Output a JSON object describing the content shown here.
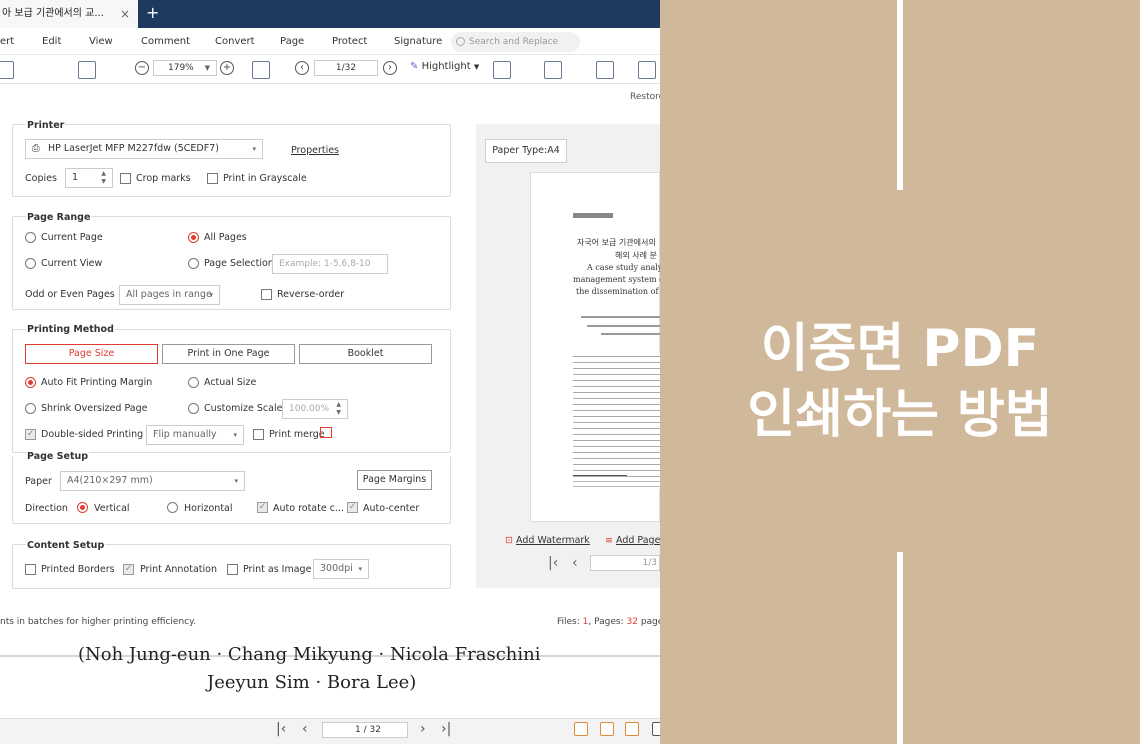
{
  "app": {
    "tab_title": "아 보급 기관에서의 교...",
    "tab_close": "×",
    "new_tab": "+",
    "menu": [
      "ert",
      "Edit",
      "View",
      "Comment",
      "Convert",
      "Page",
      "Protect",
      "Signature"
    ],
    "search_placeholder": "Search and Replace",
    "zoom": "179%",
    "page_indicator": "1/32",
    "highlight_label": "Hightlight"
  },
  "dialog": {
    "restore": "Restore",
    "printer": {
      "title": "Printer",
      "name": "HP LaserJet MFP M227fdw (5CEDF7)",
      "properties": "Properties",
      "copies_label": "Copies",
      "copies_value": "1",
      "crop_marks": "Crop marks",
      "grayscale": "Print in Grayscale"
    },
    "page_range": {
      "title": "Page Range",
      "current_page": "Current Page",
      "all_pages": "All Pages",
      "current_view": "Current View",
      "page_selection": "Page Selection",
      "selection_placeholder": "Example: 1-5,6,8-10",
      "odd_even_label": "Odd or Even Pages",
      "odd_even_value": "All pages in range",
      "reverse_order": "Reverse-order"
    },
    "printing_method": {
      "title": "Printing Method",
      "tabs": [
        "Page Size",
        "Print in One Page",
        "Booklet"
      ],
      "auto_fit": "Auto Fit Printing Margin",
      "actual_size": "Actual Size",
      "shrink": "Shrink Oversized Page",
      "custom_scale": "Customize Scale",
      "scale_value": "100.00%",
      "double_sided": "Double-sided Printing",
      "flip_value": "Flip manually",
      "print_merge": "Print merge"
    },
    "page_setup": {
      "title": "Page Setup",
      "paper_label": "Paper",
      "paper_value": "A4(210×297 mm)",
      "page_margins": "Page Margins",
      "direction_label": "Direction",
      "vertical": "Vertical",
      "horizontal": "Horizontal",
      "auto_rotate": "Auto rotate c...",
      "auto_center": "Auto-center"
    },
    "content_setup": {
      "title": "Content Setup",
      "printed_borders": "Printed Borders",
      "print_annotation": "Print Annotation",
      "print_as_image": "Print as Image",
      "dpi_value": "300dpi"
    },
    "preview": {
      "paper_type": "Paper Type:A4",
      "add_watermark": "Add Watermark",
      "add_page": "Add Page",
      "page_value": "1/3",
      "doc_title_1": "자국어 보급 기관에서의",
      "doc_title_2": "해외 사례 분",
      "doc_sub_1": "A case study analys",
      "doc_sub_2": "management system of",
      "doc_sub_3": "the dissemination of th"
    },
    "footer_note": "nts in batches for higher printing efficiency.",
    "files_label": "Files:",
    "files_count": "1",
    "pages_label": ", Pages:",
    "pages_count": "32",
    "pages_suffix": "pages"
  },
  "document": {
    "line1": "(Noh Jung-eun · Chang Mikyung · Nicola Fraschini",
    "line2": "Jeeyun Sim · Bora Lee)"
  },
  "statusbar": {
    "page_value": "1 / 32"
  },
  "banner": {
    "line1": "이중면 PDF",
    "line2": "인쇄하는 방법",
    "bg_color": "#d0b89b"
  }
}
